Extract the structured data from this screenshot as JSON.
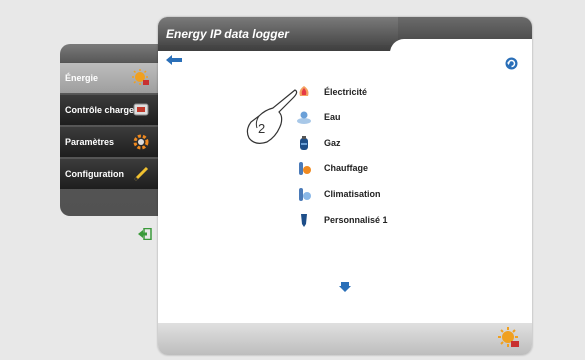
{
  "panel": {
    "title": "Energy IP data logger"
  },
  "sidebar": {
    "items": [
      {
        "label": "Énergie",
        "icon": "energy-icon"
      },
      {
        "label": "Contrôle charges",
        "icon": "load-control-icon"
      },
      {
        "label": "Paramètres",
        "icon": "gear-icon"
      },
      {
        "label": "Configuration",
        "icon": "pencil-icon"
      }
    ],
    "exit_icon": "exit-icon"
  },
  "energy_types": [
    {
      "label": "Électricité",
      "icon": "electricity-icon"
    },
    {
      "label": "Eau",
      "icon": "water-icon"
    },
    {
      "label": "Gaz",
      "icon": "gas-icon"
    },
    {
      "label": "Chauffage",
      "icon": "heating-icon"
    },
    {
      "label": "Climatisation",
      "icon": "air-conditioning-icon"
    },
    {
      "label": "Personnalisé 1",
      "icon": "custom-icon"
    }
  ],
  "annotation": {
    "step": "2"
  },
  "colors": {
    "accent_blue": "#2a6fb8",
    "header_dark": "#4a4a4a",
    "menu_dark": "#1e1e1e",
    "active_gray": "#b0b0b0"
  }
}
